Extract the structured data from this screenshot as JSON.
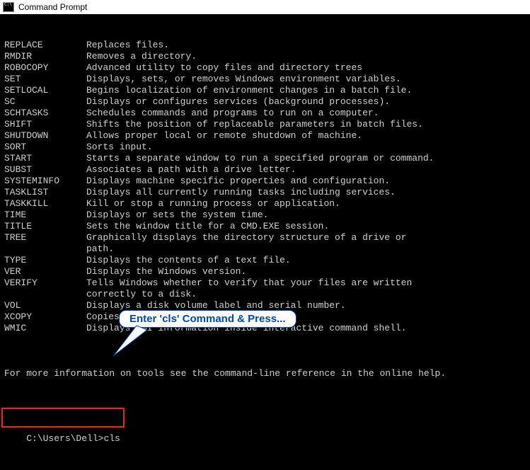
{
  "window": {
    "title": "Command Prompt"
  },
  "commands": [
    {
      "name": "REPLACE",
      "desc": "Replaces files."
    },
    {
      "name": "RMDIR",
      "desc": "Removes a directory."
    },
    {
      "name": "ROBOCOPY",
      "desc": "Advanced utility to copy files and directory trees"
    },
    {
      "name": "SET",
      "desc": "Displays, sets, or removes Windows environment variables."
    },
    {
      "name": "SETLOCAL",
      "desc": "Begins localization of environment changes in a batch file."
    },
    {
      "name": "SC",
      "desc": "Displays or configures services (background processes)."
    },
    {
      "name": "SCHTASKS",
      "desc": "Schedules commands and programs to run on a computer."
    },
    {
      "name": "SHIFT",
      "desc": "Shifts the position of replaceable parameters in batch files."
    },
    {
      "name": "SHUTDOWN",
      "desc": "Allows proper local or remote shutdown of machine."
    },
    {
      "name": "SORT",
      "desc": "Sorts input."
    },
    {
      "name": "START",
      "desc": "Starts a separate window to run a specified program or command."
    },
    {
      "name": "SUBST",
      "desc": "Associates a path with a drive letter."
    },
    {
      "name": "SYSTEMINFO",
      "desc": "Displays machine specific properties and configuration."
    },
    {
      "name": "TASKLIST",
      "desc": "Displays all currently running tasks including services."
    },
    {
      "name": "TASKKILL",
      "desc": "Kill or stop a running process or application."
    },
    {
      "name": "TIME",
      "desc": "Displays or sets the system time."
    },
    {
      "name": "TITLE",
      "desc": "Sets the window title for a CMD.EXE session."
    },
    {
      "name": "TREE",
      "desc": "Graphically displays the directory structure of a drive or\npath."
    },
    {
      "name": "TYPE",
      "desc": "Displays the contents of a text file."
    },
    {
      "name": "VER",
      "desc": "Displays the Windows version."
    },
    {
      "name": "VERIFY",
      "desc": "Tells Windows whether to verify that your files are written\ncorrectly to a disk."
    },
    {
      "name": "VOL",
      "desc": "Displays a disk volume label and serial number."
    },
    {
      "name": "XCOPY",
      "desc": "Copies files and directory trees."
    },
    {
      "name": "WMIC",
      "desc": "Displays WMI information inside interactive command shell."
    }
  ],
  "footer": {
    "more_info": "For more information on tools see the command-line reference in the online help."
  },
  "prompt": {
    "path": "C:\\Users\\Dell>",
    "input": "cls"
  },
  "callout": {
    "text": "Enter 'cls' Command & Press..."
  }
}
